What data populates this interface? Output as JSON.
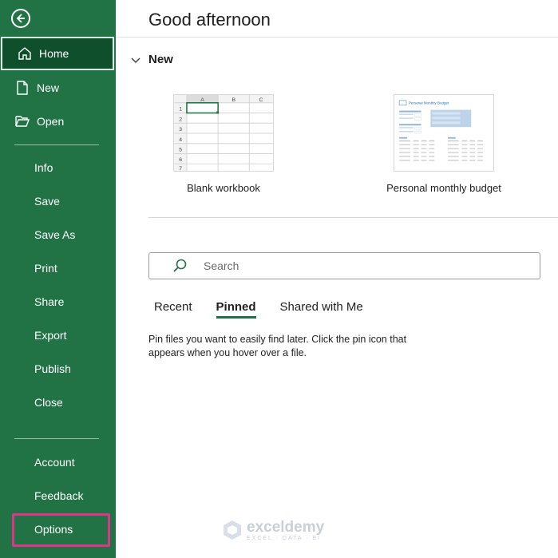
{
  "sidebar": {
    "items": [
      {
        "label": "Home",
        "icon": "home-icon",
        "active": true
      },
      {
        "label": "New",
        "icon": "new-document-icon"
      },
      {
        "label": "Open",
        "icon": "folder-open-icon"
      },
      {
        "label": "Info"
      },
      {
        "label": "Save"
      },
      {
        "label": "Save As"
      },
      {
        "label": "Print"
      },
      {
        "label": "Share"
      },
      {
        "label": "Export"
      },
      {
        "label": "Publish"
      },
      {
        "label": "Close"
      },
      {
        "label": "Account"
      },
      {
        "label": "Feedback"
      },
      {
        "label": "Options",
        "highlighted": true
      }
    ],
    "background": "#217346",
    "highlight_color": "#e0348a"
  },
  "main": {
    "greeting": "Good afternoon",
    "new_section": {
      "title": "New",
      "templates": [
        {
          "name": "Blank workbook",
          "columns": [
            "A",
            "B",
            "C"
          ],
          "rows": [
            "1",
            "2",
            "3",
            "4",
            "5",
            "6",
            "7"
          ]
        },
        {
          "name": "Personal monthly budget",
          "thumb_title": "Personal Monthly Budget"
        }
      ]
    },
    "search": {
      "placeholder": "Search"
    },
    "tabs": [
      {
        "label": "Recent"
      },
      {
        "label": "Pinned",
        "active": true
      },
      {
        "label": "Shared with Me"
      }
    ],
    "pinned_hint": "Pin files you want to easily find later. Click the pin icon that appears when you hover over a file."
  },
  "watermark": {
    "name": "exceldemy",
    "tagline": "EXCEL · DATA · BI"
  },
  "accent": "#217346"
}
